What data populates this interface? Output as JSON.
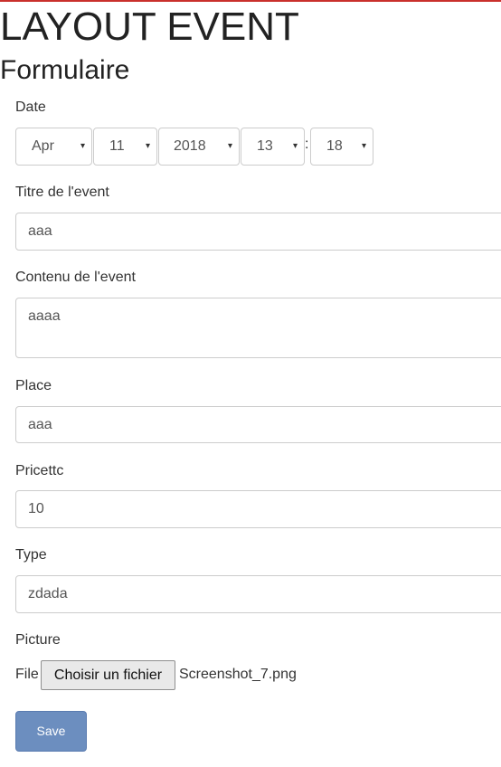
{
  "page": {
    "title": "LAYOUT EVENT",
    "subtitle": "Formulaire"
  },
  "form": {
    "date": {
      "label": "Date",
      "month": "Apr",
      "day": "11",
      "year": "2018",
      "hour": "13",
      "separator": ":",
      "minute": "18",
      "arrow_icon": "▾"
    },
    "titre": {
      "label": "Titre de l'event",
      "value": "aaa"
    },
    "contenu": {
      "label": "Contenu de l'event",
      "value": "aaaa"
    },
    "place": {
      "label": "Place",
      "value": "aaa"
    },
    "price": {
      "label": "Pricettc",
      "value": "10"
    },
    "type": {
      "label": "Type",
      "value": "zdada"
    },
    "picture": {
      "label": "Picture",
      "file_label": "File",
      "button_label": "Choisir un fichier",
      "file_name": "Screenshot_7.png"
    },
    "save_label": "Save"
  },
  "colors": {
    "accent_button": "#6c8ebf",
    "top_border": "#c9302c",
    "input_border": "#cccccc"
  }
}
